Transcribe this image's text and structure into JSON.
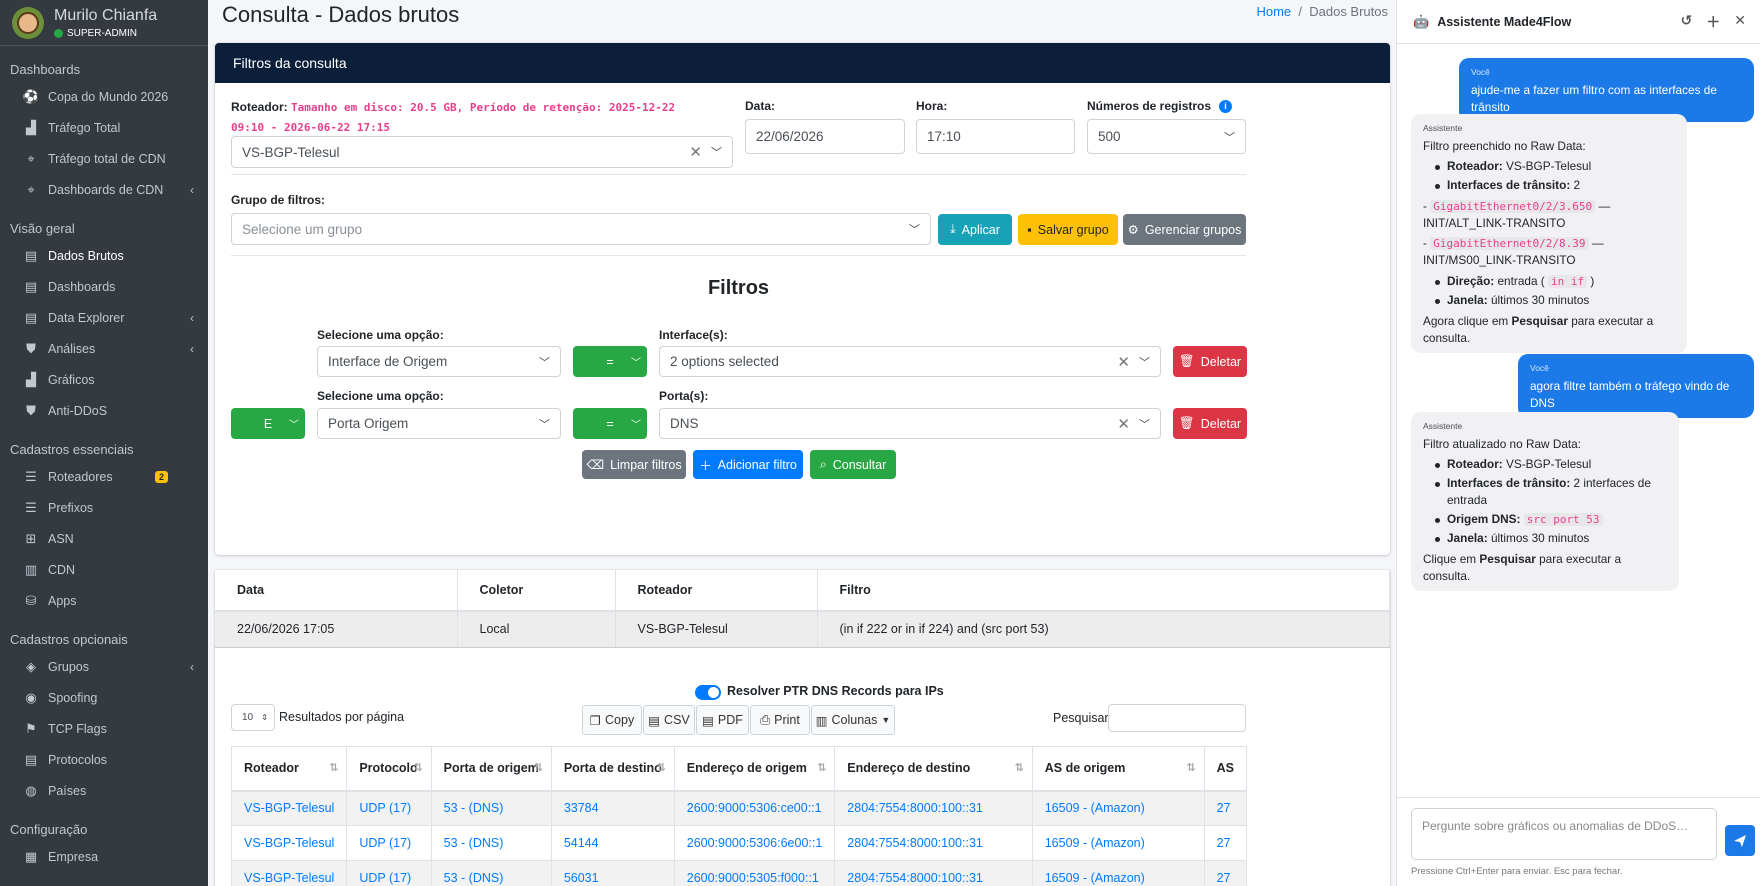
{
  "sidebar": {
    "user_name": "Murilo Chianfa",
    "user_role": "SUPER-ADMIN",
    "sections": [
      {
        "title": "Dashboards",
        "items": [
          {
            "label": "Copa do Mundo 2026",
            "icon": "soccer-icon"
          },
          {
            "label": "Tráfego Total",
            "icon": "chart-icon"
          },
          {
            "label": "Tráfego total de CDN",
            "icon": "antenna-icon"
          },
          {
            "label": "Dashboards de CDN",
            "icon": "antenna-icon",
            "arrow": true
          }
        ]
      },
      {
        "title": "Visão geral",
        "items": [
          {
            "label": "Dados Brutos",
            "icon": "file-icon",
            "active": true
          },
          {
            "label": "Dashboards",
            "icon": "file-icon"
          },
          {
            "label": "Data Explorer",
            "icon": "file-icon",
            "arrow": true
          },
          {
            "label": "Análises",
            "icon": "shield-icon",
            "arrow": true
          },
          {
            "label": "Gráficos",
            "icon": "chart-icon"
          },
          {
            "label": "Anti-DDoS",
            "icon": "shield-icon"
          }
        ]
      },
      {
        "title": "Cadastros essenciais",
        "items": [
          {
            "label": "Roteadores",
            "icon": "list-icon",
            "badge": "2"
          },
          {
            "label": "Prefixos",
            "icon": "list-icon"
          },
          {
            "label": "ASN",
            "icon": "network-icon"
          },
          {
            "label": "CDN",
            "icon": "server-icon"
          },
          {
            "label": "Apps",
            "icon": "database-icon"
          }
        ]
      },
      {
        "title": "Cadastros opcionais",
        "items": [
          {
            "label": "Grupos",
            "icon": "layers-icon",
            "arrow": true
          },
          {
            "label": "Spoofing",
            "icon": "mask-icon"
          },
          {
            "label": "TCP Flags",
            "icon": "flag-icon"
          },
          {
            "label": "Protocolos",
            "icon": "file-icon"
          },
          {
            "label": "Países",
            "icon": "globe-icon"
          }
        ]
      },
      {
        "title": "Configuração",
        "items": [
          {
            "label": "Empresa",
            "icon": "building-icon"
          }
        ]
      }
    ]
  },
  "page": {
    "title": "Consulta - Dados brutos",
    "breadcrumb_home": "Home",
    "breadcrumb_sep": "/",
    "breadcrumb_current": "Dados Brutos"
  },
  "filters_card": {
    "header": "Filtros da consulta",
    "router_label": "Roteador:",
    "router_info": "Tamanho em disco: 20.5 GB, Período de retenção: 2025-12-22 09:10 - 2026-06-22 17:15",
    "router_value": "VS-BGP-Telesul",
    "date_label": "Data:",
    "date_value": "22/06/2026",
    "time_label": "Hora:",
    "time_value": "17:10",
    "records_label": "Números de registros",
    "records_value": "500",
    "group_label": "Grupo de filtros:",
    "group_placeholder": "Selecione um grupo",
    "apply_btn": "Aplicar",
    "save_btn": "Salvar grupo",
    "manage_btn": "Gerenciar grupos",
    "filters_title": "Filtros",
    "rows": [
      {
        "option_label": "Selecione uma opção:",
        "option_value": "Interface de Origem",
        "op": "=",
        "value_label": "Interface(s):",
        "value": "2 options selected",
        "delete": "Deletar"
      },
      {
        "logic": "E",
        "option_label": "Selecione uma opção:",
        "option_value": "Porta Origem",
        "op": "=",
        "value_label": "Porta(s):",
        "value": "DNS",
        "delete": "Deletar"
      }
    ],
    "clear_btn": "Limpar filtros",
    "add_btn": "Adicionar filtro",
    "query_btn": "Consultar"
  },
  "summary": {
    "headers": [
      "Data",
      "Coletor",
      "Roteador",
      "Filtro"
    ],
    "row": [
      "22/06/2026 17:05",
      "Local",
      "VS-BGP-Telesul",
      "(in if 222 or in if 224) and (src port 53)"
    ]
  },
  "datatable": {
    "ptr_label": "Resolver PTR DNS Records para IPs",
    "page_size": "10",
    "page_size_label": "Resultados por página",
    "buttons": [
      "Copy",
      "CSV",
      "PDF",
      "Print",
      "Colunas"
    ],
    "search_label": "Pesquisar",
    "headers": [
      "Roteador",
      "Protocolo",
      "Porta de origem",
      "Porta de destino",
      "Endereço de origem",
      "Endereço de destino",
      "AS de origem",
      "AS"
    ],
    "rows": [
      [
        "VS-BGP-Telesul",
        "UDP (17)",
        "53 - (DNS)",
        "33784",
        "2600:9000:5306:ce00::1",
        "2804:7554:8000:100::31",
        "16509 - (Amazon)",
        "27"
      ],
      [
        "VS-BGP-Telesul",
        "UDP (17)",
        "53 - (DNS)",
        "54144",
        "2600:9000:5306:6e00::1",
        "2804:7554:8000:100::31",
        "16509 - (Amazon)",
        "27"
      ],
      [
        "VS-BGP-Telesul",
        "UDP (17)",
        "53 - (DNS)",
        "56031",
        "2600:9000:5305:f000::1",
        "2804:7554:8000:100::31",
        "16509 - (Amazon)",
        "27"
      ]
    ]
  },
  "assistant": {
    "title": "Assistente Made4Flow",
    "m1_who": "Você",
    "m1_text": "ajude-me a fazer um filtro com as interfaces de trânsito",
    "m2_who": "Assistente",
    "m2_intro": "Filtro preenchido no Raw Data:",
    "m2_router_k": "Roteador:",
    "m2_router_v": "VS-BGP-Telesul",
    "m2_if_k": "Interfaces de trânsito:",
    "m2_if_v": "2",
    "m2_if1_code": "GigabitEthernet0/2/3.650",
    "m2_if1_desc": "— INIT/ALT_LINK-TRANSITO",
    "m2_if2_code": "GigabitEthernet0/2/8.39",
    "m2_if2_desc": "— INIT/MS00_LINK-TRANSITO",
    "m2_dir_k": "Direção:",
    "m2_dir_v": "entrada (",
    "m2_dir_code": "in if",
    "m2_dir_end": ")",
    "m2_win_k": "Janela:",
    "m2_win_v": "últimos 30 minutos",
    "m2_out_a": "Agora clique em",
    "m2_out_b": "Pesquisar",
    "m2_out_c": "para executar a consulta.",
    "m3_who": "Você",
    "m3_text": "agora filtre também o tráfego vindo de DNS",
    "m4_who": "Assistente",
    "m4_intro": "Filtro atualizado no Raw Data:",
    "m4_router_k": "Roteador:",
    "m4_router_v": "VS-BGP-Telesul",
    "m4_if_k": "Interfaces de trânsito:",
    "m4_if_v": "2 interfaces de entrada",
    "m4_dns_k": "Origem DNS:",
    "m4_dns_code": "src port 53",
    "m4_win_k": "Janela:",
    "m4_win_v": "últimos 30 minutos",
    "m4_out_a": "Clique em",
    "m4_out_b": "Pesquisar",
    "m4_out_c": "para executar a consulta.",
    "input_placeholder": "Pergunte sobre gráficos ou anomalias de DDoS…",
    "hint": "Pressione Ctrl+Enter para enviar. Esc para fechar."
  },
  "colors": {
    "sidebar": "#343a40",
    "card_header": "#0c1f3a",
    "primary": "#007bff",
    "success": "#28a745",
    "danger": "#dc3545",
    "info": "#17a2b8",
    "warning": "#ffc107",
    "secondary": "#6c757d"
  }
}
